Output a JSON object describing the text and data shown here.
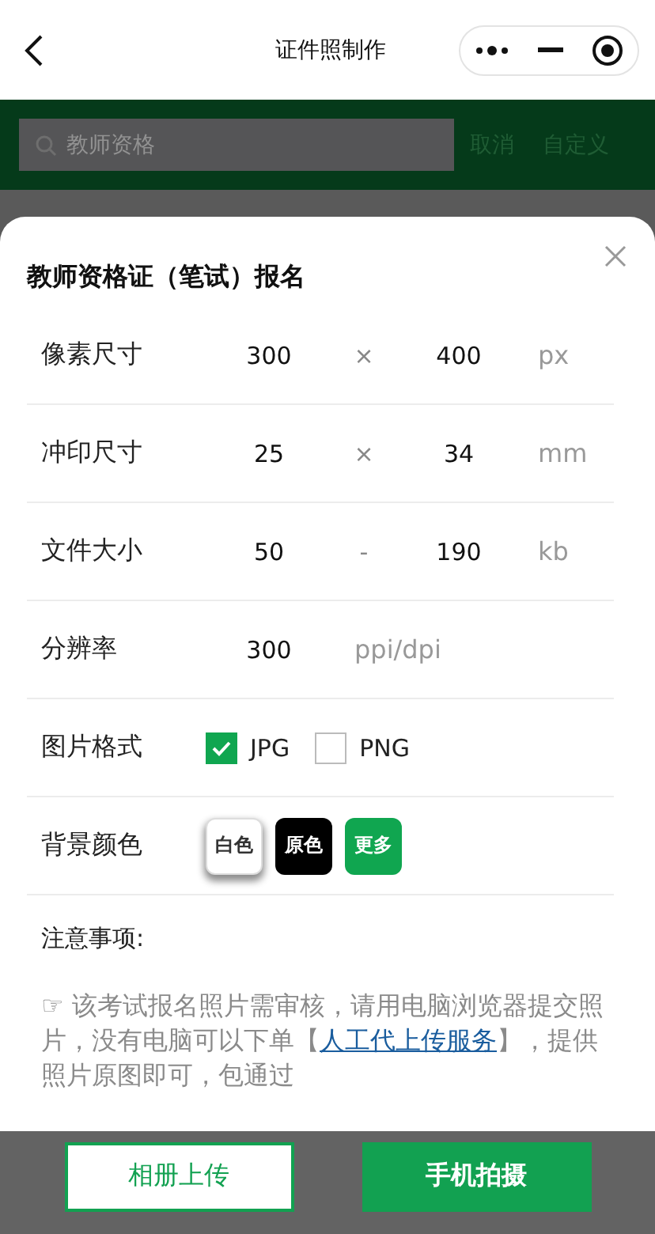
{
  "header": {
    "title": "证件照制作"
  },
  "search": {
    "value": "教师资格",
    "actions": [
      "取消",
      "自定义"
    ]
  },
  "sheet": {
    "title": "教师资格证（笔试）报名",
    "rows": [
      {
        "kind": "range",
        "label": "像素尺寸",
        "from": "300",
        "separator": "×",
        "to": "400",
        "unit": "px"
      },
      {
        "kind": "range",
        "label": "冲印尺寸",
        "from": "25",
        "separator": "×",
        "to": "34",
        "unit": "mm"
      },
      {
        "kind": "range",
        "label": "文件大小",
        "from": "50",
        "separator": "-",
        "to": "190",
        "unit": "kb"
      },
      {
        "kind": "single",
        "label": "分辨率",
        "value": "300",
        "unit": "ppi/dpi"
      },
      {
        "kind": "formats",
        "label": "图片格式",
        "options": [
          {
            "label": "JPG",
            "checked": true
          },
          {
            "label": "PNG",
            "checked": false
          }
        ]
      },
      {
        "kind": "colors",
        "label": "背景颜色",
        "options": [
          {
            "label": "白色",
            "color": "#ffffff",
            "selected": true
          },
          {
            "label": "原色",
            "color": "#000000",
            "selected": false
          },
          {
            "label": "更多",
            "color": "#10a650",
            "selected": false
          }
        ]
      }
    ],
    "notice": {
      "title": "注意事项:",
      "before": "☞ 该考试报名照片需审核，请用电脑浏览器提交照片，没有电脑可以下单【",
      "link": "人工代上传服务",
      "after": "】，提供照片原图即可，包通过"
    }
  },
  "buttons": [
    {
      "kind": "outline",
      "label": "相册上传"
    },
    {
      "kind": "filled",
      "label": "手机拍摄"
    }
  ]
}
